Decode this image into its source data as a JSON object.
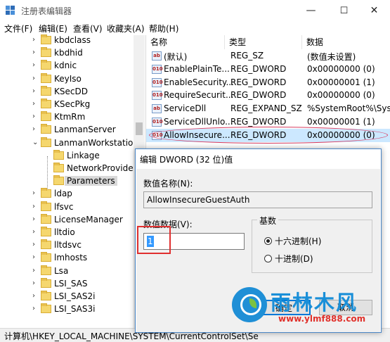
{
  "window": {
    "title": "注册表编辑器",
    "controls": {
      "minimize": "—",
      "maximize": "☐",
      "close": "✕"
    }
  },
  "menu": [
    "文件(F)",
    "编辑(E)",
    "查看(V)",
    "收藏夹(A)",
    "帮助(H)"
  ],
  "tree": {
    "items": [
      {
        "label": "kbdclass",
        "expander": "›"
      },
      {
        "label": "kbdhid",
        "expander": "›"
      },
      {
        "label": "kdnic",
        "expander": "›"
      },
      {
        "label": "KeyIso",
        "expander": "›"
      },
      {
        "label": "KSecDD",
        "expander": "›"
      },
      {
        "label": "KSecPkg",
        "expander": "›"
      },
      {
        "label": "KtmRm",
        "expander": "›"
      },
      {
        "label": "LanmanServer",
        "expander": "›"
      },
      {
        "label": "LanmanWorkstation",
        "expander": "⌄"
      },
      {
        "label": "Linkage",
        "expander": ""
      },
      {
        "label": "NetworkProvider",
        "expander": ""
      },
      {
        "label": "Parameters",
        "expander": "",
        "selected": true
      },
      {
        "label": "ldap",
        "expander": "›"
      },
      {
        "label": "lfsvc",
        "expander": "›"
      },
      {
        "label": "LicenseManager",
        "expander": "›"
      },
      {
        "label": "lltdio",
        "expander": "›"
      },
      {
        "label": "lltdsvc",
        "expander": "›"
      },
      {
        "label": "lmhosts",
        "expander": "›"
      },
      {
        "label": "Lsa",
        "expander": "›"
      },
      {
        "label": "LSI_SAS",
        "expander": "›"
      },
      {
        "label": "LSI_SAS2i",
        "expander": "›"
      },
      {
        "label": "LSI_SAS3i",
        "expander": "›"
      }
    ]
  },
  "list": {
    "headers": {
      "name": "名称",
      "type": "类型",
      "data": "数据"
    },
    "rows": [
      {
        "icon": "ab",
        "name": "(默认)",
        "type": "REG_SZ",
        "data": "(数值未设置)"
      },
      {
        "icon": "010",
        "name": "EnablePlainTe...",
        "type": "REG_DWORD",
        "data": "0x00000000 (0)"
      },
      {
        "icon": "010",
        "name": "EnableSecurity...",
        "type": "REG_DWORD",
        "data": "0x00000001 (1)"
      },
      {
        "icon": "010",
        "name": "RequireSecurit...",
        "type": "REG_DWORD",
        "data": "0x00000000 (0)"
      },
      {
        "icon": "ab",
        "name": "ServiceDll",
        "type": "REG_EXPAND_SZ",
        "data": "%SystemRoot%\\Syster"
      },
      {
        "icon": "010",
        "name": "ServiceDllUnlo...",
        "type": "REG_DWORD",
        "data": "0x00000001 (1)"
      },
      {
        "icon": "010",
        "name": "AllowInsecure...",
        "type": "REG_DWORD",
        "data": "0x00000000 (0)",
        "selected": true
      }
    ]
  },
  "status": "计算机\\HKEY_LOCAL_MACHINE\\SYSTEM\\CurrentControlSet\\Se",
  "dialog": {
    "title": "编辑 DWORD (32 位)值",
    "name_label": "数值名称(N):",
    "name_value": "AllowInsecureGuestAuth",
    "data_label": "数值数据(V):",
    "data_value": "1",
    "base_label": "基数",
    "radio_hex": "十六进制(H)",
    "radio_dec": "十进制(D)",
    "ok_label": "确定",
    "cancel_label": "取消"
  },
  "watermark": {
    "brand": "雨林木风",
    "url": "www.ylmf888.com"
  },
  "colors": {
    "accent": "#0078d7",
    "selection": "#cce8ff",
    "highlight_red": "#e03030",
    "watermark_blue": "#1a8fd8"
  }
}
